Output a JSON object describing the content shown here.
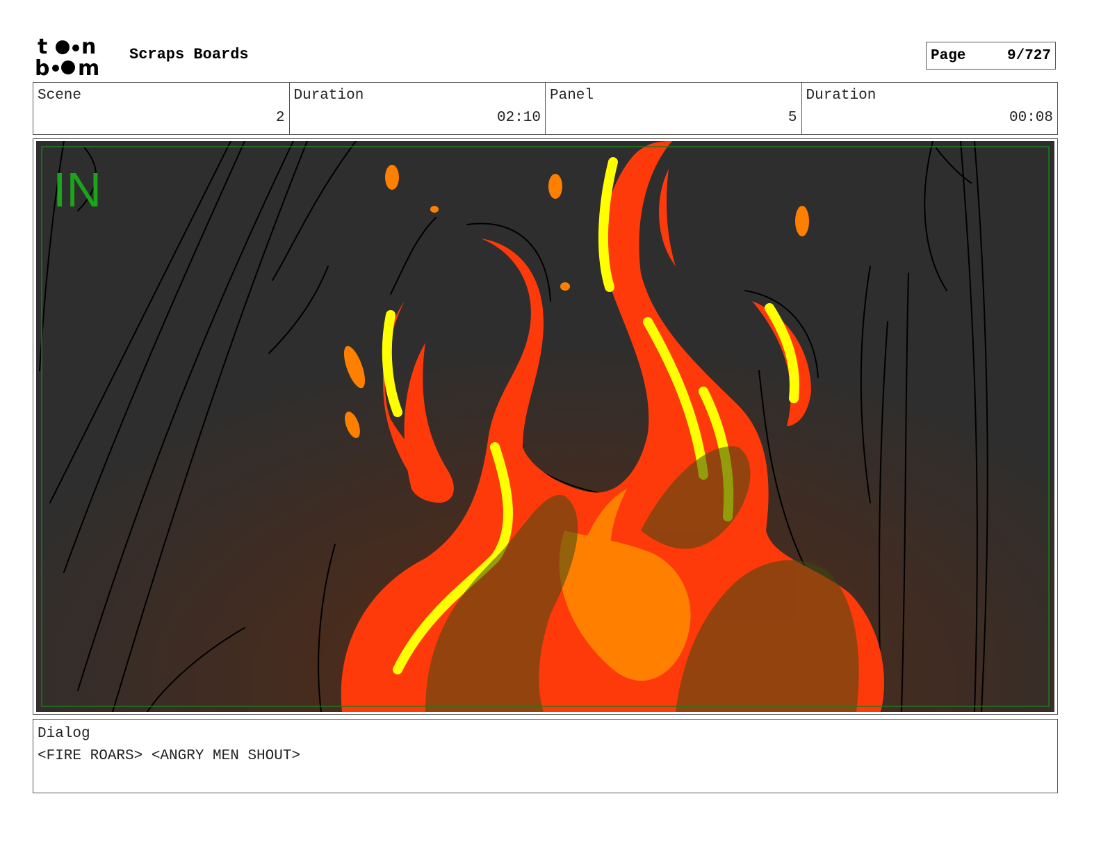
{
  "header": {
    "logo_text": "toon boom",
    "project_title": "Scraps Boards",
    "page_label": "Page",
    "page_number": "9/727"
  },
  "info": {
    "scene_label": "Scene",
    "scene_value": "2",
    "scene_duration_label": "Duration",
    "scene_duration_value": "02:10",
    "panel_label": "Panel",
    "panel_value": "5",
    "panel_duration_label": "Duration",
    "panel_duration_value": "00:08"
  },
  "panel": {
    "overlay_text": "IN",
    "colors": {
      "background_dark": "#2e2e2e",
      "background_glow": "#5a2a12",
      "flame_red": "#ff3a0a",
      "flame_orange": "#ff7f00",
      "flame_yellow": "#ffff00",
      "safe_area": "#1e7a1e",
      "overlay_text": "#1aa51a"
    }
  },
  "dialog": {
    "label": "Dialog",
    "text": "<FIRE ROARS> <ANGRY MEN SHOUT>"
  }
}
